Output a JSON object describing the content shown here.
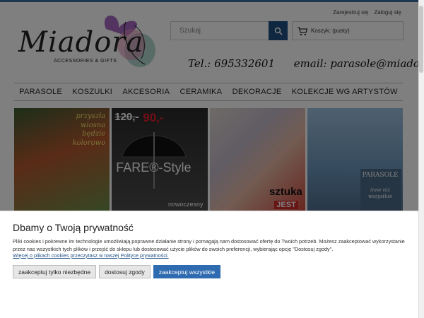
{
  "header": {
    "logo_script": "Miadora",
    "logo_sub": "ACCESSORIES & GIFTS",
    "search_placeholder": "Szukaj",
    "cart_label": "Koszyk: (pusty)",
    "account_links": [
      "Zarejestruj się",
      "Zaloguj się"
    ],
    "phone": "Tel.: 695332601",
    "email": "email: parasole@miadora"
  },
  "nav": {
    "items": [
      "PARASOLE",
      "KOSZULKI",
      "AKCESORIA",
      "CERAMIKA",
      "DEKORACJE",
      "KOLEKCJE WG ARTYSTÓW"
    ]
  },
  "banners": {
    "b1_text": "przyszła wiosna będzie kolorowo",
    "b2_price_old": "120,-",
    "b2_price_new": "90,-",
    "b2_brand": "FARE®-Style",
    "b2_sub": "nowoczesny",
    "b3_text": "sztuka",
    "b3_text2": "JEST",
    "b4_title": "PARASOLE",
    "b4_sub": "inne niż wszystkie"
  },
  "cookie": {
    "title": "Dbamy o Twoją prywatność",
    "text": "Pliki cookies i pokrewne im technologie umożliwiają poprawne działanie strony i pomagają nam dostosować ofertę do Twoich potrzeb. Możesz zaakceptować wykorzystanie przez nas wszystkich tych plików i przejść do sklepu lub dostosować użycie plików do swoich preferencji, wybierając opcję \"Dostosuj zgody\".",
    "link": "Więcej o plikach cookies przeczytasz w naszej Polityce prywatności.",
    "buttons": {
      "necessary": "zaakceptuj tylko niezbędne",
      "customize": "dostosuj zgody",
      "accept_all": "zaakceptuj wszystkie"
    }
  },
  "colors": {
    "accent": "#2f6bb0",
    "search_button": "#1f4f82",
    "overlay": "rgba(0,0,0,0.5)"
  }
}
